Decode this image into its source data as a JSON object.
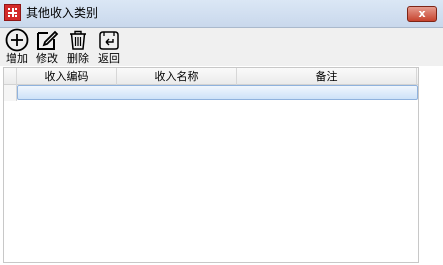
{
  "window": {
    "title": "其他收入类别",
    "close_glyph": "x"
  },
  "toolbar": {
    "items": [
      {
        "label": "增加",
        "icon": "plus-circle-icon"
      },
      {
        "label": "修改",
        "icon": "edit-icon"
      },
      {
        "label": "删除",
        "icon": "trash-icon"
      },
      {
        "label": "返回",
        "icon": "back-icon"
      }
    ]
  },
  "grid": {
    "columns": [
      "收入编码",
      "收入名称",
      "备注"
    ],
    "rows": [
      {
        "code": "",
        "name": "",
        "note": ""
      }
    ]
  },
  "colors": {
    "accent": "#3f6fb1",
    "selection_bg": "#cde2f8",
    "close_button": "#c7432e"
  }
}
